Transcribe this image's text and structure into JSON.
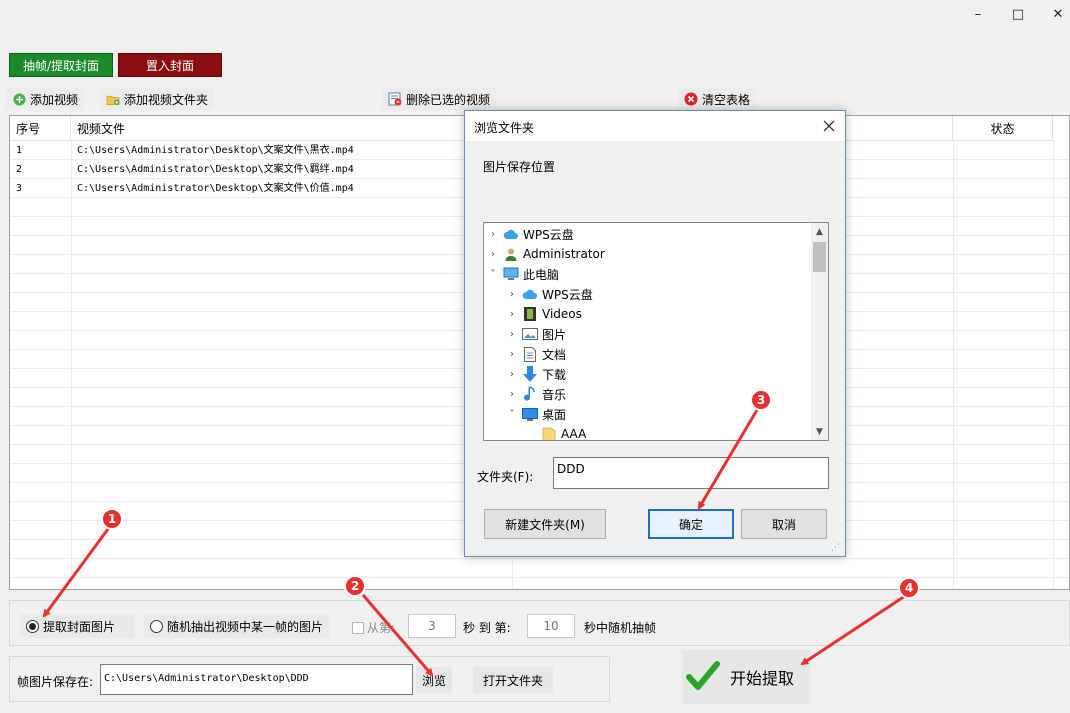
{
  "window": {
    "minimize": "–",
    "maximize": "□",
    "close": "✕"
  },
  "modes": {
    "extract_tab": "抽帧/提取封面",
    "insert_tab": "置入封面"
  },
  "toolbar": {
    "add_video": "添加视频",
    "add_folder": "添加视频文件夹",
    "delete_selected": "删除已选的视频",
    "clear_table": "清空表格"
  },
  "table": {
    "columns": [
      "序号",
      "视频文件",
      "状态"
    ],
    "rows": [
      {
        "index": "1",
        "file": "C:\\Users\\Administrator\\Desktop\\文案文件\\黑衣.mp4"
      },
      {
        "index": "2",
        "file": "C:\\Users\\Administrator\\Desktop\\文案文件\\羁绊.mp4"
      },
      {
        "index": "3",
        "file": "C:\\Users\\Administrator\\Desktop\\文案文件\\价值.mp4"
      }
    ]
  },
  "options": {
    "radio_cover": "提取封面图片",
    "radio_random": "随机抽出视频中某一帧的图片",
    "from_label": "从第:",
    "from_value": "3",
    "to_label": "秒 到 第:",
    "to_value": "10",
    "suffix": "秒中随机抽帧",
    "save_label": "帧图片保存在:",
    "save_path": "C:\\Users\\Administrator\\Desktop\\DDD",
    "browse": "浏览",
    "open_folder": "打开文件夹",
    "start": "开始提取"
  },
  "dialog": {
    "title": "浏览文件夹",
    "prompt": "图片保存位置",
    "tree": [
      {
        "label": "WPS云盘",
        "icon": "cloud-icon",
        "level": 0,
        "chevron": "›"
      },
      {
        "label": "Administrator",
        "icon": "user-icon",
        "level": 0,
        "chevron": "›"
      },
      {
        "label": "此电脑",
        "icon": "computer-icon",
        "level": 0,
        "chevron": "˅"
      },
      {
        "label": "WPS云盘",
        "icon": "cloud-icon",
        "level": 1,
        "chevron": "›"
      },
      {
        "label": "Videos",
        "icon": "film-icon",
        "level": 1,
        "chevron": "›"
      },
      {
        "label": "图片",
        "icon": "picture-icon",
        "level": 1,
        "chevron": "›"
      },
      {
        "label": "文档",
        "icon": "document-icon",
        "level": 1,
        "chevron": "›"
      },
      {
        "label": "下载",
        "icon": "download-icon",
        "level": 1,
        "chevron": "›"
      },
      {
        "label": "音乐",
        "icon": "music-icon",
        "level": 1,
        "chevron": "›"
      },
      {
        "label": "桌面",
        "icon": "desktop-icon",
        "level": 1,
        "chevron": "˅"
      },
      {
        "label": "AAA",
        "icon": "folder-icon",
        "level": 2,
        "chevron": ""
      }
    ],
    "folder_label": "文件夹(F):",
    "folder_value": "DDD",
    "new_folder": "新建文件夹(M)",
    "ok": "确定",
    "cancel": "取消"
  },
  "annotations": [
    "1",
    "2",
    "3",
    "4"
  ],
  "colors": {
    "extract_tab": "#1b8a2a",
    "insert_tab": "#8b0e0e",
    "annotation": "#e8302e",
    "start_check": "#2aa52a"
  }
}
